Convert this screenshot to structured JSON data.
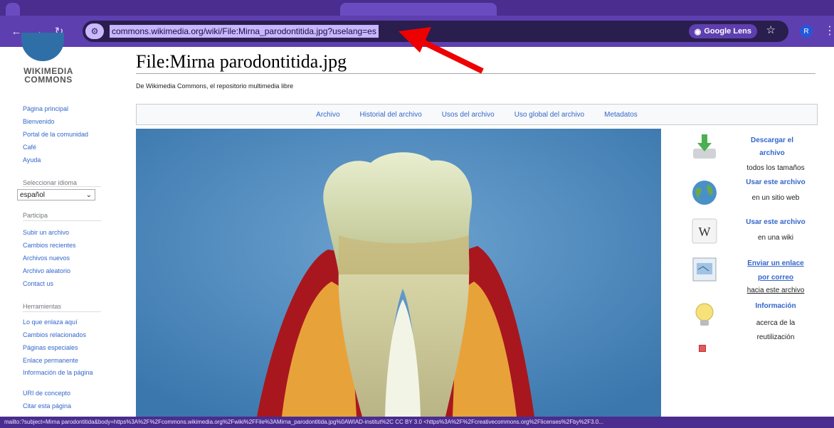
{
  "browser": {
    "url": "commons.wikimedia.org/wiki/File:Mirna_parodontitida.jpg?uselang=es",
    "lens_label": "Google Lens",
    "profile_initial": "R"
  },
  "sidebar": {
    "logo_line1": "WIKIMEDIA",
    "logo_line2": "COMMONS",
    "main_links": [
      "Página principal",
      "Bienvenido",
      "Portal de la comunidad",
      "Café",
      "Ayuda"
    ],
    "language_heading": "Seleccionar idioma",
    "language_value": "español",
    "participate_heading": "Participa",
    "participate_links": [
      "Subir un archivo",
      "Cambios recientes",
      "Archivos nuevos",
      "Archivo aleatorio",
      "Contact us"
    ],
    "tools_heading": "Herramientas",
    "tools_links": [
      "Lo que enlaza aquí",
      "Cambios relacionados",
      "Páginas especiales",
      "Enlace permanente",
      "Información de la página",
      "URI de concepto",
      "Citar esta página"
    ]
  },
  "page": {
    "title": "File:Mirna parodontitida.jpg",
    "subtitle": "De Wikimedia Commons, el repositorio multimedia libre",
    "tabs": [
      "Archivo",
      "Historial del archivo",
      "Usos del archivo",
      "Uso global del archivo",
      "Metadatos"
    ]
  },
  "actions": {
    "download_title_1": "Descargar el",
    "download_title_2": "archivo",
    "download_sub": "todos los tamaños",
    "use_web_title": "Usar este archivo",
    "use_web_sub": "en un sitio web",
    "use_wiki_title": "Usar este archivo",
    "use_wiki_sub": "en una wiki",
    "email_title_1": "Enviar un enlace",
    "email_title_2": "por correo",
    "email_sub": "hacia este archivo",
    "info_title": "Información",
    "info_sub_1": "acerca de la",
    "info_sub_2": "reutilización"
  },
  "status": {
    "text": "mailto:?subject=Mirna parodontitida&body=https%3A%2F%2Fcommons.wikimedia.org%2Fwiki%2FFile%3AMirna_parodontitida.jpg%0AWIAD-institut%2C CC BY 3.0 <https%3A%2F%2Fcreativecommons.org%2Flicenses%2Fby%2F3.0..."
  },
  "colors": {
    "accent": "#5e3fb0",
    "link": "#3366cc"
  }
}
